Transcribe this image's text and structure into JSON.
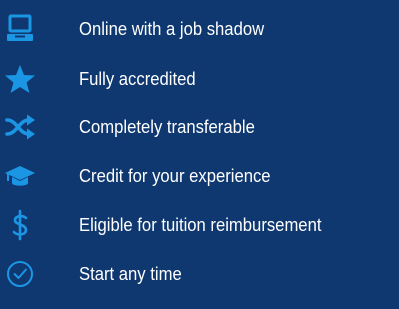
{
  "colors": {
    "background": "#0f3870",
    "icon": "#1b96e4",
    "text": "#ffffff"
  },
  "features": [
    {
      "label": "Online with a job shadow",
      "icon": "laptop-icon"
    },
    {
      "label": "Fully accredited",
      "icon": "star-icon"
    },
    {
      "label": "Completely transferable",
      "icon": "shuffle-icon"
    },
    {
      "label": "Credit for your experience",
      "icon": "graduation-cap-icon"
    },
    {
      "label": "Eligible for tuition reimbursement",
      "icon": "dollar-sign-icon"
    },
    {
      "label": "Start any time",
      "icon": "clock-icon"
    }
  ]
}
